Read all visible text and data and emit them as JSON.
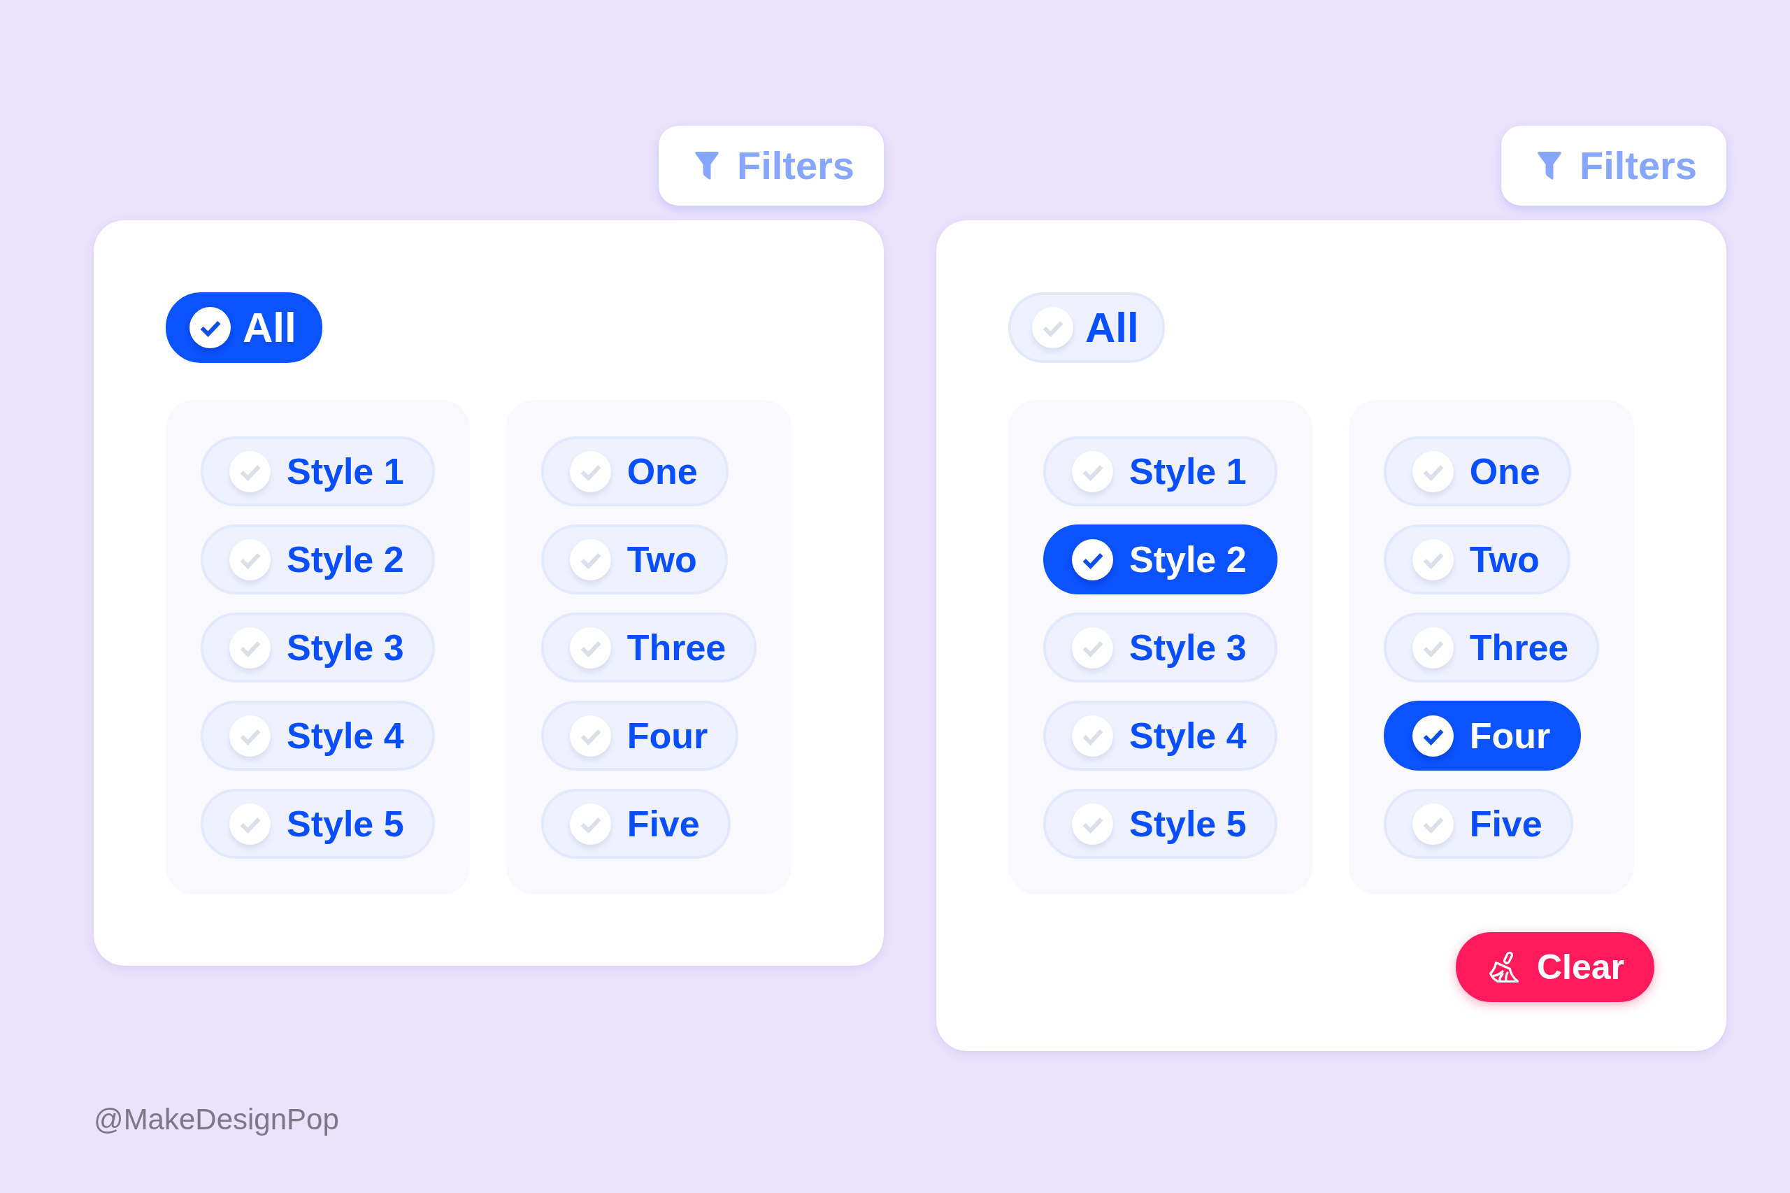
{
  "panels": [
    {
      "filters_button": {
        "label": "Filters"
      },
      "all_option": {
        "label": "All",
        "selected": true
      },
      "groups": [
        {
          "options": [
            {
              "label": "Style 1",
              "selected": false
            },
            {
              "label": "Style 2",
              "selected": false
            },
            {
              "label": "Style 3",
              "selected": false
            },
            {
              "label": "Style 4",
              "selected": false
            },
            {
              "label": "Style 5",
              "selected": false
            }
          ]
        },
        {
          "options": [
            {
              "label": "One",
              "selected": false
            },
            {
              "label": "Two",
              "selected": false
            },
            {
              "label": "Three",
              "selected": false
            },
            {
              "label": "Four",
              "selected": false
            },
            {
              "label": "Five",
              "selected": false
            }
          ]
        }
      ]
    },
    {
      "filters_button": {
        "label": "Filters"
      },
      "all_option": {
        "label": "All",
        "selected": false
      },
      "groups": [
        {
          "options": [
            {
              "label": "Style 1",
              "selected": false
            },
            {
              "label": "Style 2",
              "selected": true
            },
            {
              "label": "Style 3",
              "selected": false
            },
            {
              "label": "Style 4",
              "selected": false
            },
            {
              "label": "Style 5",
              "selected": false
            }
          ]
        },
        {
          "options": [
            {
              "label": "One",
              "selected": false
            },
            {
              "label": "Two",
              "selected": false
            },
            {
              "label": "Three",
              "selected": false
            },
            {
              "label": "Four",
              "selected": true
            },
            {
              "label": "Five",
              "selected": false
            }
          ]
        }
      ],
      "clear_button": {
        "label": "Clear"
      }
    }
  ],
  "credit": "@MakeDesignPop"
}
